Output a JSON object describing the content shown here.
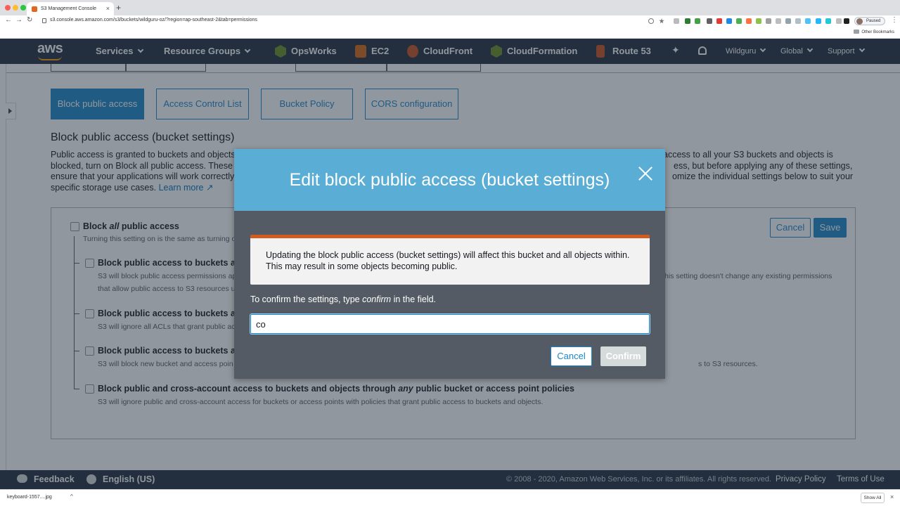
{
  "browser": {
    "tab_title": "S3 Management Console",
    "tab_close": "×",
    "new_tab": "+",
    "back": "←",
    "forward": "→",
    "reload": "↻",
    "url": "s3.console.aws.amazon.com/s3/buckets/wildguru-oz/?region=ap-southeast-2&tab=permissions",
    "profile_status": "Paused",
    "menu": "⋮",
    "bookmark_folder": "Other Bookmarks"
  },
  "aws_nav": {
    "logo": "aws",
    "services": "Services",
    "resource_groups": "Resource Groups",
    "opsworks": "OpsWorks",
    "ec2": "EC2",
    "cloudfront": "CloudFront",
    "cloudformation": "CloudFormation",
    "route53": "Route 53",
    "account": "Wildguru",
    "region": "Global",
    "support": "Support",
    "pin_glyph": "✦"
  },
  "subtabs": {
    "block_public_access": "Block public access",
    "acl": "Access Control List",
    "bucket_policy": "Bucket Policy",
    "cors": "CORS configuration"
  },
  "section": {
    "title": "Block public access (bucket settings)",
    "desc_left_1": "Public access is granted to buckets and objects",
    "desc_left_2": "blocked, turn on Block all public access. These",
    "desc_left_3": "ensure that your applications will work correctly",
    "desc_left_4": "specific storage use cases.",
    "learn_more": "Learn more",
    "desc_right_1": "access to all your S3 buckets and objects is",
    "desc_right_2": "ess, but before applying any of these settings,",
    "desc_right_3": "omize the individual settings below to suit your"
  },
  "panel": {
    "cancel": "Cancel",
    "save": "Save",
    "block_all_prefix": "Block ",
    "block_all_em": "all",
    "block_all_suffix": " public access",
    "block_all_desc": "Turning this setting on is the same as turning o",
    "opt1_title": "Block public access to buckets an",
    "opt1_desc_a": "S3 will block public access permissions ap",
    "opt1_desc_b": "that allow public access to S3 resources u",
    "opt1_desc_right": "his setting doesn't change any existing permissions",
    "opt2_title": "Block public access to buckets an",
    "opt2_desc": "S3 will ignore all ACLs that grant public ac",
    "opt3_title": "Block public access to buckets an",
    "opt3_desc": "S3 will block new bucket and access poin",
    "opt3_desc_right": "s to S3 resources.",
    "opt4_title_a": "Block public and cross-account access to buckets and objects through ",
    "opt4_title_em": "any",
    "opt4_title_b": " public bucket or access point policies",
    "opt4_desc": "S3 will ignore public and cross-account access for buckets or access points with policies that grant public access to buckets and objects."
  },
  "modal": {
    "title": "Edit block public access (bucket settings)",
    "alert_line1": "Updating the block public access (bucket settings) will affect this bucket and all objects within.",
    "alert_line2": "This may result in some objects becoming public.",
    "confirm_prefix": "To confirm the settings, type ",
    "confirm_word": "confirm",
    "confirm_suffix": " in the field.",
    "input_value": "co",
    "cancel": "Cancel",
    "confirm": "Confirm"
  },
  "footer": {
    "feedback": "Feedback",
    "language": "English (US)",
    "copyright": "© 2008 - 2020, Amazon Web Services, Inc. or its affiliates. All rights reserved.",
    "privacy": "Privacy Policy",
    "terms": "Terms of Use"
  },
  "downloads": {
    "file": "keyboard-1557....jpg",
    "caret": "^",
    "show_all": "Show All",
    "close": "×"
  },
  "colors": {
    "aws_nav": "#232f3e",
    "accent_blue": "#1a86c8",
    "modal_header": "#5aaed6",
    "alert_orange": "#d35b1f",
    "aws_orange": "#ff9900"
  }
}
